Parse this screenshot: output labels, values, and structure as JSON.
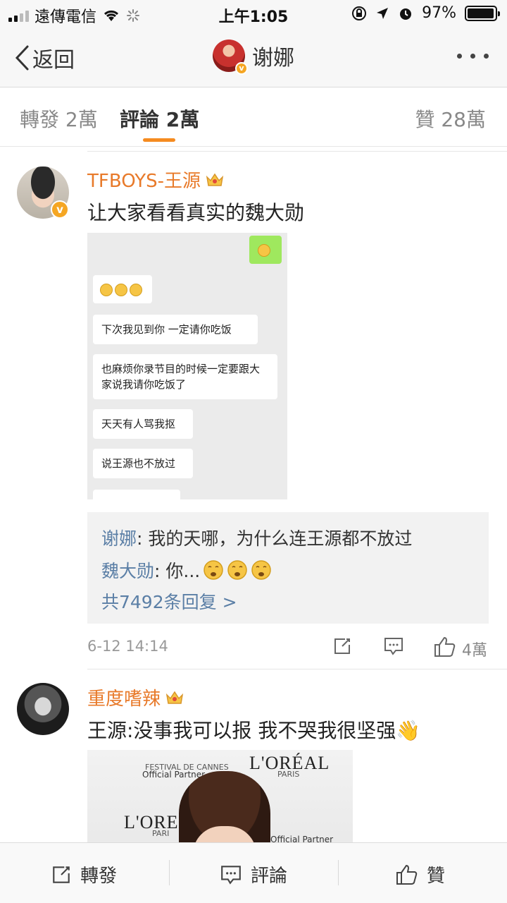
{
  "status_bar": {
    "carrier": "遠傳電信",
    "time": "上午1:05",
    "battery": "97%",
    "battery_level": 0.97
  },
  "nav": {
    "back_label": "返回",
    "title": "谢娜"
  },
  "tabs": {
    "repost": "轉發 2萬",
    "comment": "評論 2萬",
    "like": "贊 28萬"
  },
  "comments": [
    {
      "username": "TFBOYS-王源",
      "text": "让大家看看真实的魏大勋",
      "chat_image": {
        "bubbles": [
          "下次我见到你 一定请你吃饭",
          "也麻烦你录节目的时候一定要跟大家说我请你吃饭了",
          "天天有人骂我抠",
          "说王源也不放过"
        ]
      },
      "replies": [
        {
          "name": "谢娜",
          "text": ": 我的天哪，为什么连王源都不放过"
        },
        {
          "name": "魏大勋",
          "text": ": 你..."
        }
      ],
      "more_replies": "共7492条回复 >",
      "time": "6-12 14:14",
      "likes": "4萬"
    },
    {
      "username": "重度嗜辣",
      "text": "王源:没事我可以报 我不哭我很坚强👋",
      "photo": {
        "logo_main": "L'ORÉAL",
        "logo_sub": "PARIS",
        "logo_main_2": "L'ORE",
        "logo_sub_2": "PARI",
        "festival": "FESTIVAL DE CANNES",
        "partner": "Official Partner"
      }
    }
  ],
  "bottom_bar": {
    "repost": "轉發",
    "comment": "評論",
    "like": "贊"
  },
  "colors": {
    "accent_orange": "#f58b20",
    "username_orange": "#e87a2a",
    "link_blue": "#5b7fa6",
    "verified_badge": "#f5a623"
  },
  "icons": [
    "wifi-icon",
    "loading-icon",
    "lock-rotation-icon",
    "location-icon",
    "alarm-icon",
    "share-icon",
    "comment-icon",
    "like-icon"
  ]
}
